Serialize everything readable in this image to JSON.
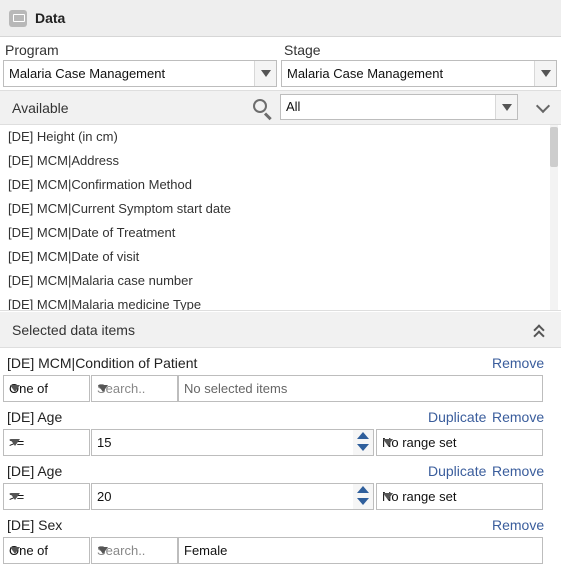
{
  "panel": {
    "title": "Data",
    "icon": "data-icon"
  },
  "program": {
    "label": "Program",
    "value": "Malaria Case Management"
  },
  "stage": {
    "label": "Stage",
    "value": "Malaria Case Management"
  },
  "available": {
    "label": "Available",
    "filter_value": "All",
    "items": [
      "[DE] Height (in cm)",
      "[DE] MCM|Address",
      "[DE] MCM|Confirmation Method",
      "[DE] MCM|Current Symptom start date",
      "[DE] MCM|Date of Treatment",
      "[DE] MCM|Date of visit",
      "[DE] MCM|Malaria case number",
      "[DE] MCM|Malaria medicine Type"
    ]
  },
  "selected": {
    "title": "Selected data items",
    "items": [
      {
        "name": "[DE] MCM|Condition of Patient",
        "operator": "One of",
        "search_placeholder": "Search..",
        "value": "No selected items",
        "remove": "Remove"
      },
      {
        "name": "[DE] Age",
        "operator": ">=",
        "value": "15",
        "range": "No range set",
        "duplicate": "Duplicate",
        "remove": "Remove"
      },
      {
        "name": "[DE] Age",
        "operator": ">=",
        "value": "20",
        "range": "No range set",
        "duplicate": "Duplicate",
        "remove": "Remove"
      },
      {
        "name": "[DE] Sex",
        "operator": "One of",
        "search_placeholder": "Search..",
        "value": "Female",
        "remove": "Remove"
      }
    ]
  }
}
